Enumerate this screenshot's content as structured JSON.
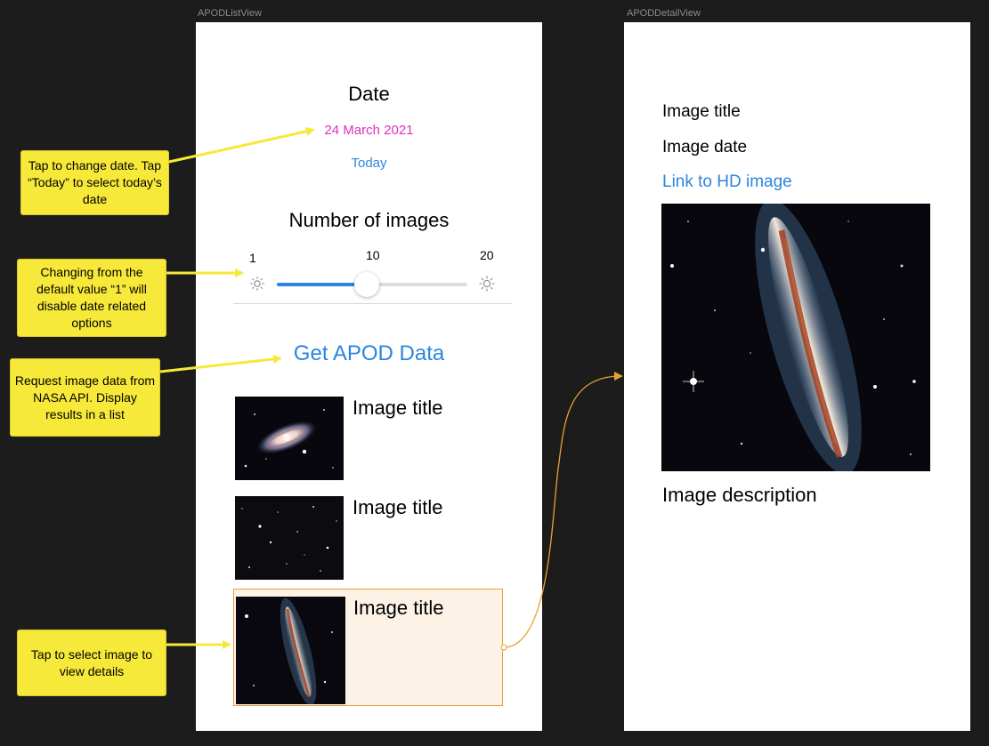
{
  "canvas": {
    "list_view_label": "APODListView",
    "detail_view_label": "APODDetailView"
  },
  "list_view": {
    "date_heading": "Date",
    "date_value": "24 March 2021",
    "today_button": "Today",
    "number_heading": "Number of images",
    "slider": {
      "min_label": "1",
      "value_label": "10",
      "max_label": "20",
      "min": 1,
      "max": 20,
      "value": 10
    },
    "get_button": "Get APOD Data",
    "rows": [
      {
        "title": "Image title",
        "image": "spiral-galaxy-thumbnail",
        "selected": false
      },
      {
        "title": "Image title",
        "image": "star-field-thumbnail",
        "selected": false
      },
      {
        "title": "Image title",
        "image": "edge-on-galaxy-thumbnail",
        "selected": true
      }
    ]
  },
  "detail_view": {
    "title": "Image title",
    "date": "Image date",
    "link": "Link to HD image",
    "image": "edge-on-galaxy-photo",
    "description": "Image description"
  },
  "callouts": {
    "date": "Tap to change date. Tap “Today” to select today’s date",
    "slider": "Changing from the default value “1” will disable date related options",
    "request": "Request image data from NASA API. Display results in a list",
    "select": "Tap to select image to view details"
  },
  "colors": {
    "accent_blue": "#2b85e0",
    "date_magenta": "#de2fc0",
    "callout_yellow": "#f7e93a",
    "segue_orange": "#e8a234",
    "selection_fill": "#fcf3e6"
  }
}
